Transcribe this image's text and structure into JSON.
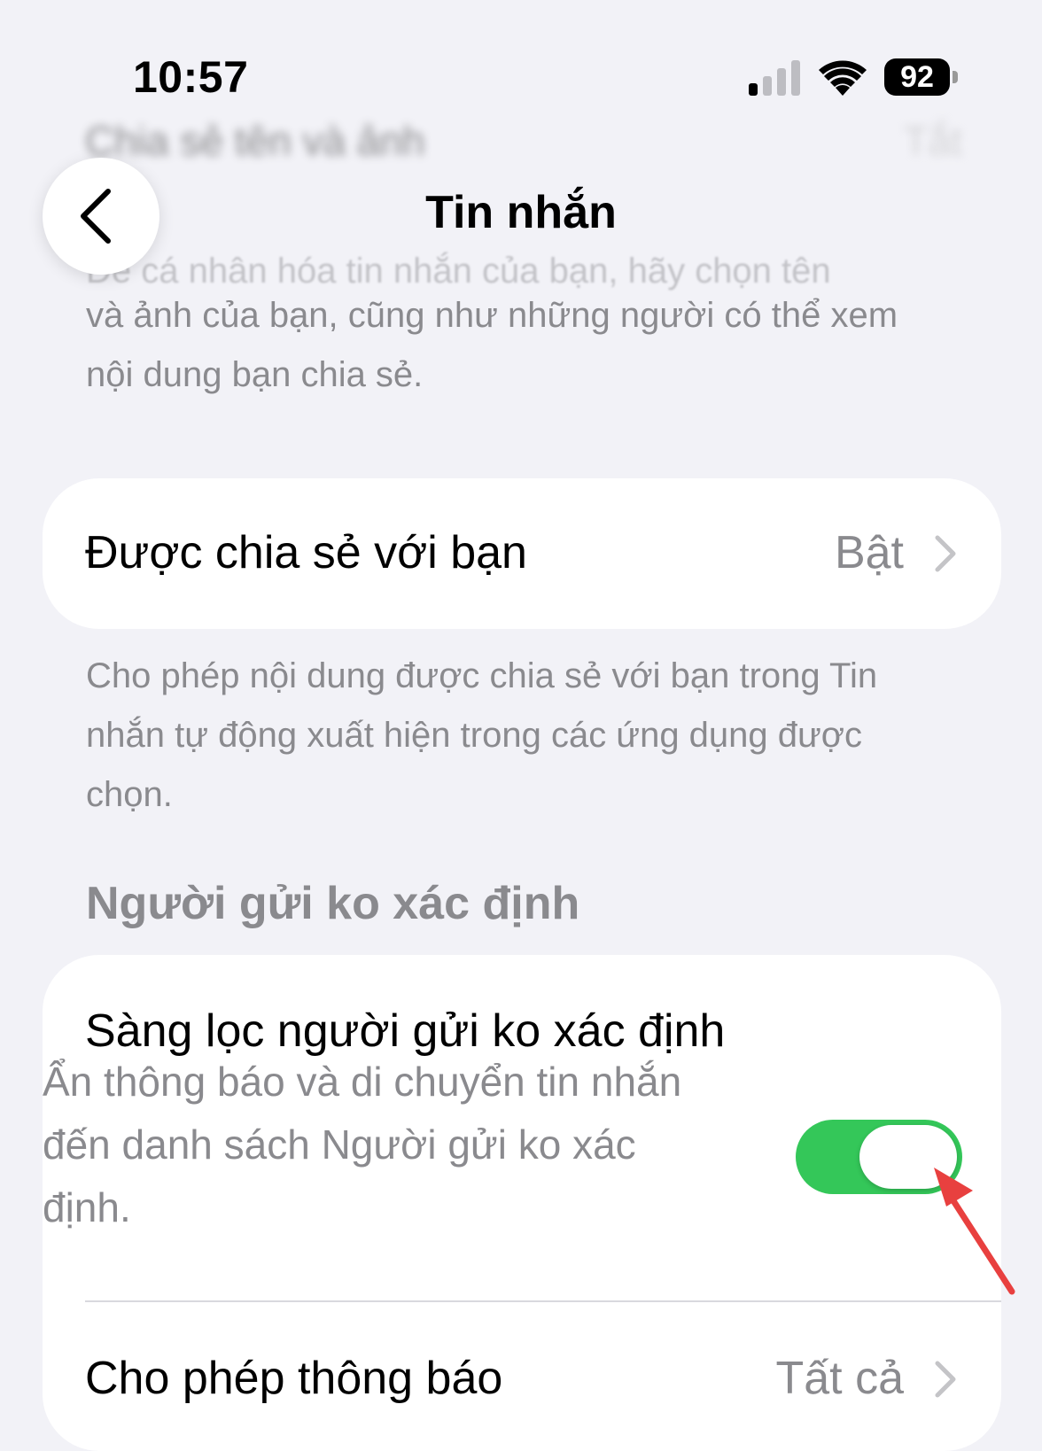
{
  "status_bar": {
    "time": "10:57",
    "battery": "92"
  },
  "blurred_row": {
    "label": "Chia sẻ tên và ảnh",
    "value": "Tắt"
  },
  "nav": {
    "title": "Tin nhắn"
  },
  "name_photo_footnote": {
    "line1": "Để cá nhân hóa tin nhắn của bạn, hãy chọn tên",
    "rest": "và ảnh của bạn, cũng như những người có thể xem nội dung bạn chia sẻ."
  },
  "shared_with_you": {
    "label": "Được chia sẻ với bạn",
    "value": "Bật"
  },
  "shared_footnote": "Cho phép nội dung được chia sẻ với bạn trong Tin nhắn tự động xuất hiện trong các ứng dụng được chọn.",
  "unknown_senders": {
    "header": "Người gửi ko xác định",
    "filter": {
      "label": "Sàng lọc người gửi ko xác định",
      "description": "Ẩn thông báo và di chuyển tin nhắn đến danh sách Người gửi ko xác định.",
      "enabled": true
    },
    "allow_notifications": {
      "label": "Cho phép thông báo",
      "value": "Tất cả"
    }
  },
  "colors": {
    "toggle_on": "#34c759",
    "arrow": "#e8403f",
    "secondary_text": "#8a8a8e",
    "background": "#f2f2f7"
  }
}
